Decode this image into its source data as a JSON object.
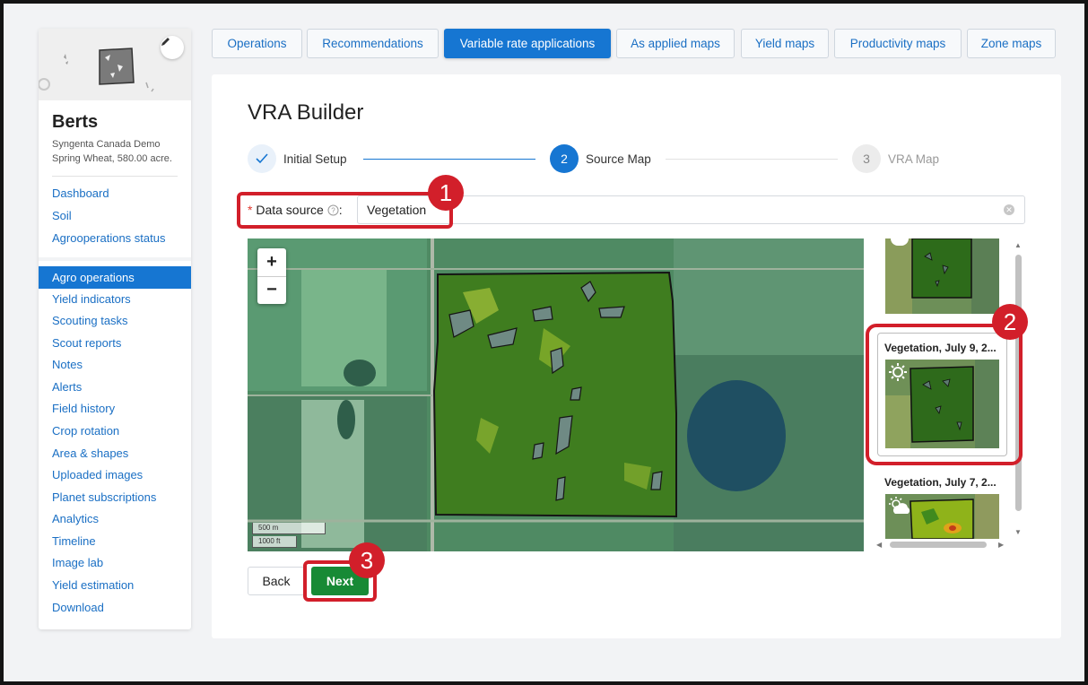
{
  "sidebar": {
    "field_name": "Berts",
    "farm": "Syngenta Canada Demo",
    "crop_area": "Spring Wheat, 580.00 acre.",
    "top_links": [
      "Dashboard",
      "Soil",
      "Agrooperations status"
    ],
    "active_item": "Agro operations",
    "links": [
      "Yield indicators",
      "Scouting tasks",
      "Scout reports",
      "Notes",
      "Alerts",
      "Field history",
      "Crop rotation",
      "Area & shapes",
      "Uploaded images",
      "Planet subscriptions",
      "Analytics",
      "Timeline",
      "Image lab",
      "Yield estimation",
      "Download"
    ]
  },
  "tabs": [
    "Operations",
    "Recommendations",
    "Variable rate applications",
    "As applied maps",
    "Yield maps",
    "Productivity maps",
    "Zone maps"
  ],
  "active_tab": "Variable rate applications",
  "main": {
    "title": "VRA Builder",
    "steps": [
      {
        "number": "1",
        "label": "Initial Setup",
        "state": "done"
      },
      {
        "number": "2",
        "label": "Source Map",
        "state": "active"
      },
      {
        "number": "3",
        "label": "VRA Map",
        "state": "pending"
      }
    ],
    "data_source": {
      "required_mark": "*",
      "label": "Data source",
      "colon": ":",
      "value": "Vegetation"
    },
    "map": {
      "zoom_in": "+",
      "zoom_out": "−",
      "scale_m": "500 m",
      "scale_ft": "1000 ft"
    },
    "images": [
      {
        "title": "Vegetation, July 9, 2...",
        "weather": "sun-icon"
      },
      {
        "title": "Vegetation, July 7, 2...",
        "weather": "partly-cloudy-icon"
      }
    ],
    "buttons": {
      "back": "Back",
      "next": "Next"
    }
  },
  "annotations": [
    "1",
    "2",
    "3"
  ],
  "colors": {
    "accent": "#1676d2",
    "next_button": "#178a35",
    "annotation": "#d21f2a",
    "link": "#1a6fc4"
  }
}
